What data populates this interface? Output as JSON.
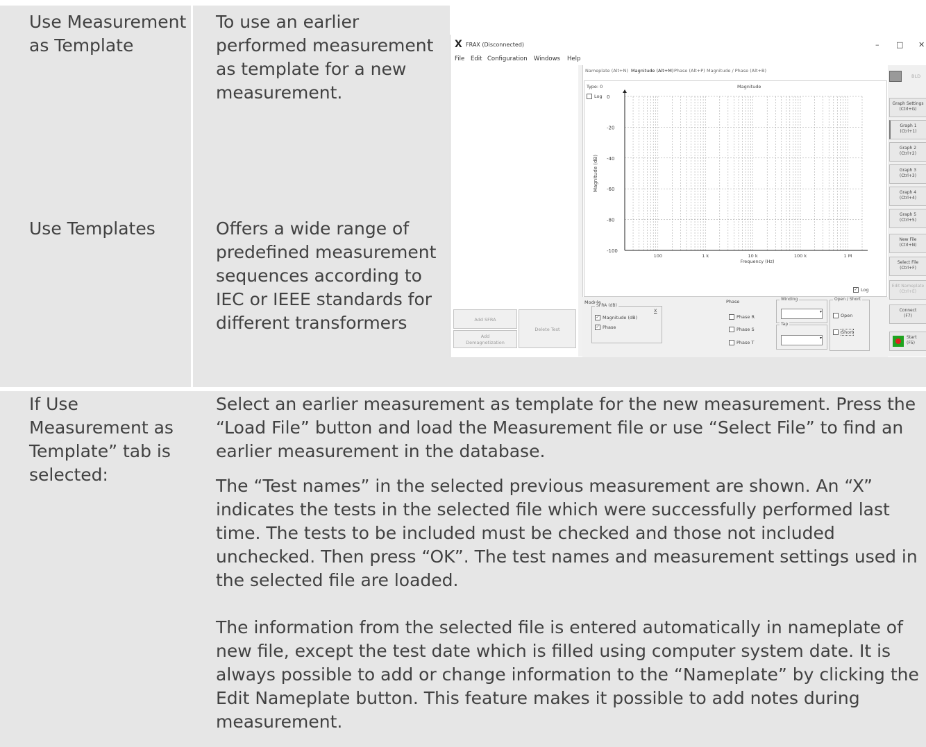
{
  "rows": [
    {
      "label": "Use Measurement as Template",
      "description": "To use an earlier performed measurement as template for a new measurement."
    },
    {
      "label": "Use Templates",
      "description": "Offers a wide range of predefined measurement sequences according to IEC or IEEE standards for different transformers"
    },
    {
      "label": "If Use Measurement as Template” tab is selected:",
      "paragraphs": [
        "Select an earlier measurement as template for the new measurement. Press the “Load File” button and load the Measurement file or use “Select File” to find an earlier measurement in the database.",
        "The “Test names” in the selected previous measurement are shown. An “X” indicates the tests in the selected file which were successfully performed last time. The tests to be included must be checked and those not included unchecked. Then press “OK”. The test names and measurement settings used in the selected file are loaded.",
        "The information from the selected file is entered automatically in nameplate of new file, except the test date which is filled using computer system date. It is always possible to add or change information to the “Nameplate” by clicking the Edit Nameplate button. This feature makes it possible to add notes during measurement."
      ]
    }
  ],
  "app": {
    "window_title": "FRAX (Disconnected)",
    "logo": "X",
    "window_controls": {
      "minimize": "–",
      "maximize": "□",
      "close": "✕"
    },
    "menu": [
      "File",
      "Edit",
      "Configuration",
      "Windows",
      "Help"
    ],
    "tabs": [
      "Nameplate (Alt+N)",
      "Magnitude (Alt+M)",
      "Phase (Alt+P)",
      "Magnitude / Phase (Alt+B)"
    ],
    "active_tab_index": 1,
    "type_label": "Type: 0",
    "log_y_label": "Log",
    "log_y_checked": false,
    "log_x_label": "Log",
    "log_x_checked": true,
    "chart_data": {
      "type": "line",
      "title": "Magnitude",
      "xlabel": "Frequency (Hz)",
      "ylabel": "Magnitude (dB)",
      "x_scale": "log",
      "xlim": [
        20,
        2000000
      ],
      "ylim": [
        -100,
        0
      ],
      "x_ticks": [
        100,
        1000,
        10000,
        100000,
        1000000
      ],
      "x_tick_labels": [
        "100",
        "1 k",
        "10 k",
        "100 k",
        "1 M"
      ],
      "y_ticks": [
        0,
        -20,
        -40,
        -60,
        -80,
        -100
      ],
      "y_tick_labels": [
        "0",
        "-20",
        "-40",
        "-60",
        "-80",
        "-100"
      ],
      "grid": true,
      "series": []
    },
    "right_buttons": [
      {
        "label": "Graph Settings",
        "shortcut": "(Ctrl+G)"
      },
      {
        "label": "Graph 1",
        "shortcut": "(Ctrl+1)"
      },
      {
        "label": "Graph 2",
        "shortcut": "(Ctrl+2)"
      },
      {
        "label": "Graph 3",
        "shortcut": "(Ctrl+3)"
      },
      {
        "label": "Graph 4",
        "shortcut": "(Ctrl+4)"
      },
      {
        "label": "Graph 5",
        "shortcut": "(Ctrl+5)"
      },
      {
        "label": "New File",
        "shortcut": "(Ctrl+N)"
      },
      {
        "label": "Select File",
        "shortcut": "(Ctrl+F)"
      },
      {
        "label": "Edit Nameplate",
        "shortcut": "(Ctrl+E)"
      },
      {
        "label": "Connect",
        "shortcut": "(F7)"
      },
      {
        "label": "Start",
        "shortcut": "(F5)"
      }
    ],
    "bld_label": "BLD",
    "left_buttons": {
      "add_sfra": "Add SFRA",
      "add_demag_line1": "Add",
      "add_demag_line2": "Demagnetization",
      "delete_test": "Delete Test"
    },
    "modules": {
      "group_label": "Module",
      "sfra_label": "SFRA (dB)",
      "sfra_close": "X",
      "magnitude_label": "Magnitude (dB)",
      "magnitude_checked": true,
      "phase_label": "Phase",
      "phase_checked": true
    },
    "phase_group": {
      "label": "Phase",
      "items": [
        "Phase R",
        "Phase S",
        "Phase T"
      ]
    },
    "winding_label": "Winding",
    "tap_label": "Tap",
    "open_short": {
      "label": "Open / Short",
      "open": "Open",
      "short": "Short"
    },
    "colors": {
      "panel": "#e6e6e6",
      "start_green": "#1fa31f",
      "start_red": "#e02020"
    }
  }
}
